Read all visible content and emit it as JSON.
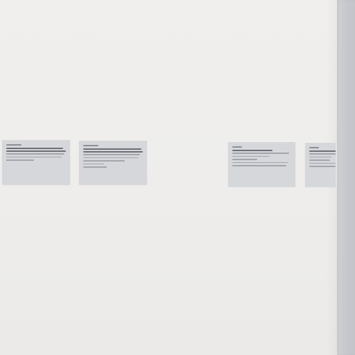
{
  "scene": {
    "wall_color": "#eeedeb",
    "side_wall_color": "#c6c8cd",
    "card_color": "#d6d7db",
    "cards": [
      {
        "id": "label-card-1"
      },
      {
        "id": "label-card-2"
      },
      {
        "id": "label-card-3"
      },
      {
        "id": "label-card-4"
      }
    ]
  }
}
